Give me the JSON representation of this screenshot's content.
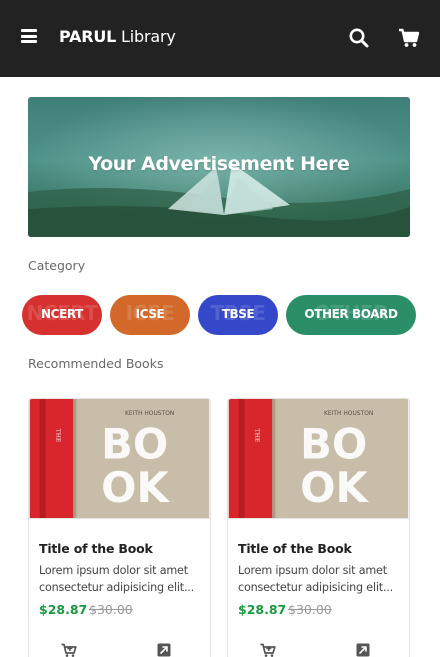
{
  "navbar": {
    "logo_bold": "PARUL",
    "logo_light": "Library",
    "icons": [
      "menu-icon",
      "search-icon",
      "cart-icon"
    ]
  },
  "advertisement": {
    "text": "Your Advertisement Here"
  },
  "category": {
    "heading": "Category",
    "items": [
      {
        "label": "NCERT",
        "color": "#d6312e",
        "ghost": "NCERT"
      },
      {
        "label": "ICSE",
        "color": "#d2692b",
        "ghost": "ICSE"
      },
      {
        "label": "TBSE",
        "color": "#3548c9",
        "ghost": "TBSE"
      },
      {
        "label": "OTHER BOARD",
        "color": "#2a8f66",
        "ghost": "OTHER"
      }
    ]
  },
  "recommended": {
    "heading": "Recommended Books",
    "books": [
      {
        "title": "Title of the Book",
        "description_line1": "Lorem ipsum dolor sit amet",
        "description_line2": "consectetur adipisicing elit...",
        "price": "$28.87",
        "old_price": "$30.00"
      },
      {
        "title": "Title of the Book",
        "description_line1": "Lorem ipsum dolor sit amet",
        "description_line2": "consectetur adipisicing elit...",
        "price": "$28.87",
        "old_price": "$30.00"
      }
    ],
    "cover": {
      "author": "KEITH HOUSTON",
      "word": "BOOK",
      "spine": "THE"
    }
  },
  "colors": {
    "navbar_bg": "#222222",
    "price_green": "#1a9a3e",
    "old_price_gray": "#9a9a9a"
  }
}
